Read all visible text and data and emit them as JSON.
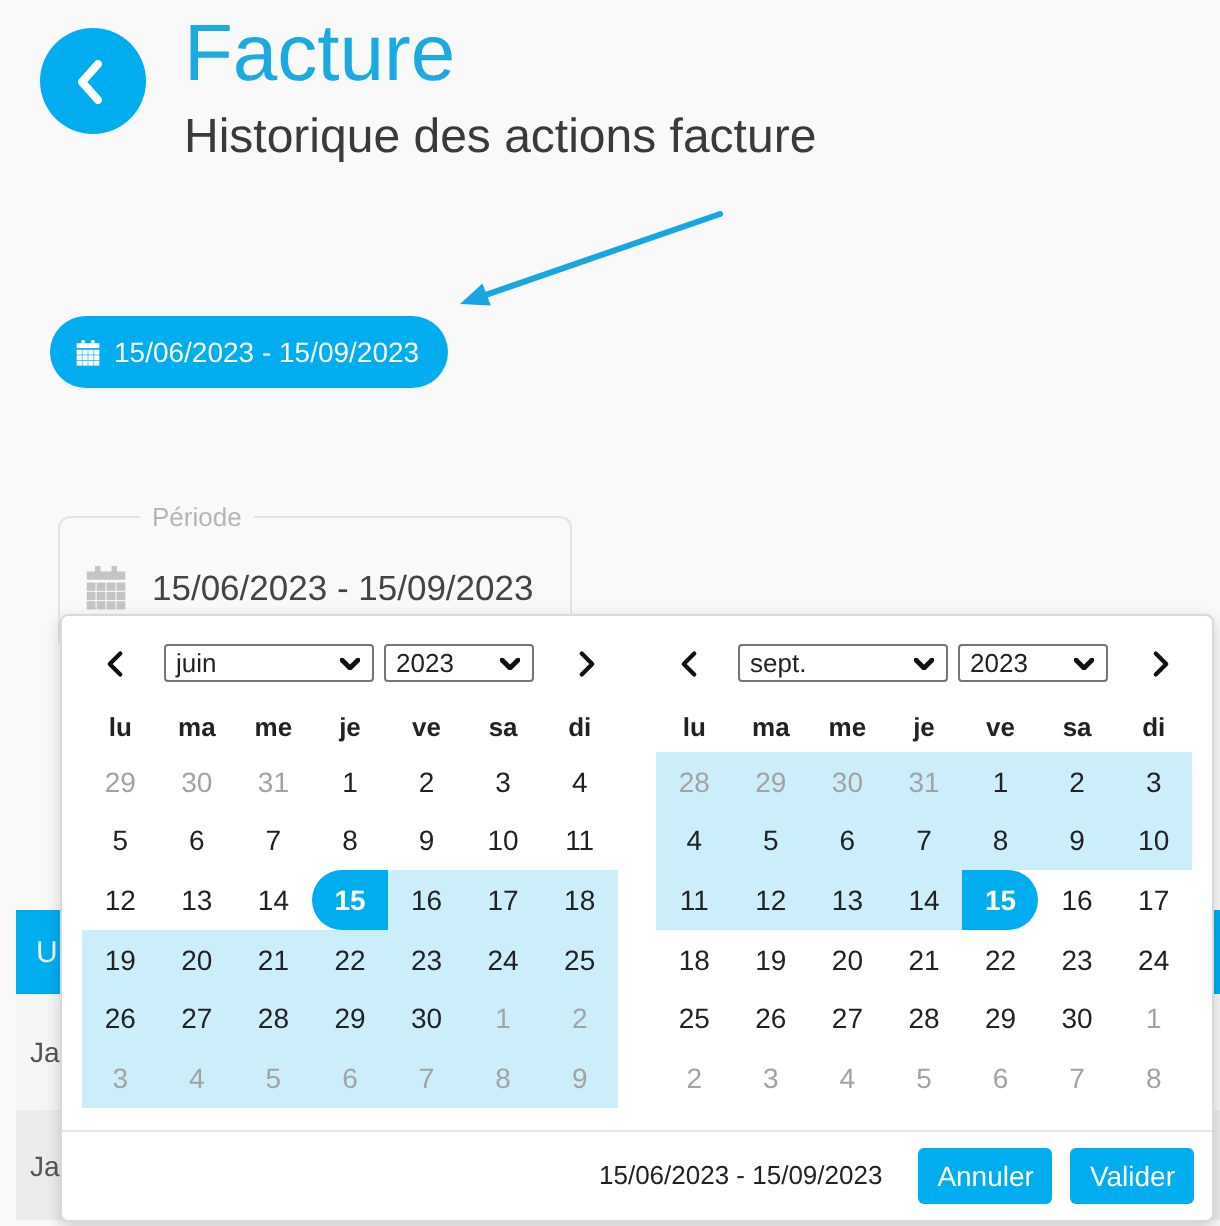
{
  "header": {
    "title": "Facture",
    "subtitle": "Historique des actions facture"
  },
  "date_button": {
    "label": "15/06/2023 - 15/09/2023"
  },
  "period_field": {
    "label": "Période",
    "value": "15/06/2023 - 15/09/2023"
  },
  "table": {
    "columns": [
      "U"
    ],
    "rows": [
      [
        "Ja"
      ],
      [
        "Ja"
      ]
    ]
  },
  "date_picker": {
    "calendars": [
      {
        "month": "juin",
        "year": "2023",
        "weekdays": [
          "lu",
          "ma",
          "me",
          "je",
          "ve",
          "sa",
          "di"
        ],
        "weeks": [
          {
            "days": [
              {
                "label": "29",
                "outside": true,
                "in_range": false,
                "selected": false
              },
              {
                "label": "30",
                "outside": true,
                "in_range": false,
                "selected": false
              },
              {
                "label": "31",
                "outside": true,
                "in_range": false,
                "selected": false
              },
              {
                "label": "1",
                "outside": false,
                "in_range": false,
                "selected": false
              },
              {
                "label": "2",
                "outside": false,
                "in_range": false,
                "selected": false
              },
              {
                "label": "3",
                "outside": false,
                "in_range": false,
                "selected": false
              },
              {
                "label": "4",
                "outside": false,
                "in_range": false,
                "selected": false
              }
            ]
          },
          {
            "days": [
              {
                "label": "5",
                "outside": false,
                "in_range": false,
                "selected": false
              },
              {
                "label": "6",
                "outside": false,
                "in_range": false,
                "selected": false
              },
              {
                "label": "7",
                "outside": false,
                "in_range": false,
                "selected": false
              },
              {
                "label": "8",
                "outside": false,
                "in_range": false,
                "selected": false
              },
              {
                "label": "9",
                "outside": false,
                "in_range": false,
                "selected": false
              },
              {
                "label": "10",
                "outside": false,
                "in_range": false,
                "selected": false
              },
              {
                "label": "11",
                "outside": false,
                "in_range": false,
                "selected": false
              }
            ]
          },
          {
            "days": [
              {
                "label": "12",
                "outside": false,
                "in_range": false,
                "selected": false
              },
              {
                "label": "13",
                "outside": false,
                "in_range": false,
                "selected": false
              },
              {
                "label": "14",
                "outside": false,
                "in_range": false,
                "selected": false
              },
              {
                "label": "15",
                "outside": false,
                "in_range": false,
                "selected": true
              },
              {
                "label": "16",
                "outside": false,
                "in_range": true,
                "selected": false
              },
              {
                "label": "17",
                "outside": false,
                "in_range": true,
                "selected": false
              },
              {
                "label": "18",
                "outside": false,
                "in_range": true,
                "selected": false
              }
            ]
          },
          {
            "days": [
              {
                "label": "19",
                "outside": false,
                "in_range": true,
                "selected": false
              },
              {
                "label": "20",
                "outside": false,
                "in_range": true,
                "selected": false
              },
              {
                "label": "21",
                "outside": false,
                "in_range": true,
                "selected": false
              },
              {
                "label": "22",
                "outside": false,
                "in_range": true,
                "selected": false
              },
              {
                "label": "23",
                "outside": false,
                "in_range": true,
                "selected": false
              },
              {
                "label": "24",
                "outside": false,
                "in_range": true,
                "selected": false
              },
              {
                "label": "25",
                "outside": false,
                "in_range": true,
                "selected": false
              }
            ]
          },
          {
            "days": [
              {
                "label": "26",
                "outside": false,
                "in_range": true,
                "selected": false
              },
              {
                "label": "27",
                "outside": false,
                "in_range": true,
                "selected": false
              },
              {
                "label": "28",
                "outside": false,
                "in_range": true,
                "selected": false
              },
              {
                "label": "29",
                "outside": false,
                "in_range": true,
                "selected": false
              },
              {
                "label": "30",
                "outside": false,
                "in_range": true,
                "selected": false
              },
              {
                "label": "1",
                "outside": true,
                "in_range": true,
                "selected": false
              },
              {
                "label": "2",
                "outside": true,
                "in_range": true,
                "selected": false
              }
            ]
          },
          {
            "days": [
              {
                "label": "3",
                "outside": true,
                "in_range": true,
                "selected": false
              },
              {
                "label": "4",
                "outside": true,
                "in_range": true,
                "selected": false
              },
              {
                "label": "5",
                "outside": true,
                "in_range": true,
                "selected": false
              },
              {
                "label": "6",
                "outside": true,
                "in_range": true,
                "selected": false
              },
              {
                "label": "7",
                "outside": true,
                "in_range": true,
                "selected": false
              },
              {
                "label": "8",
                "outside": true,
                "in_range": true,
                "selected": false
              },
              {
                "label": "9",
                "outside": true,
                "in_range": true,
                "selected": false
              }
            ]
          }
        ]
      },
      {
        "month": "sept.",
        "year": "2023",
        "weekdays": [
          "lu",
          "ma",
          "me",
          "je",
          "ve",
          "sa",
          "di"
        ],
        "weeks": [
          {
            "days": [
              {
                "label": "28",
                "outside": true,
                "in_range": true,
                "selected": false
              },
              {
                "label": "29",
                "outside": true,
                "in_range": true,
                "selected": false
              },
              {
                "label": "30",
                "outside": true,
                "in_range": true,
                "selected": false
              },
              {
                "label": "31",
                "outside": true,
                "in_range": true,
                "selected": false
              },
              {
                "label": "1",
                "outside": false,
                "in_range": true,
                "selected": false
              },
              {
                "label": "2",
                "outside": false,
                "in_range": true,
                "selected": false
              },
              {
                "label": "3",
                "outside": false,
                "in_range": true,
                "selected": false
              }
            ]
          },
          {
            "days": [
              {
                "label": "4",
                "outside": false,
                "in_range": true,
                "selected": false
              },
              {
                "label": "5",
                "outside": false,
                "in_range": true,
                "selected": false
              },
              {
                "label": "6",
                "outside": false,
                "in_range": true,
                "selected": false
              },
              {
                "label": "7",
                "outside": false,
                "in_range": true,
                "selected": false
              },
              {
                "label": "8",
                "outside": false,
                "in_range": true,
                "selected": false
              },
              {
                "label": "9",
                "outside": false,
                "in_range": true,
                "selected": false
              },
              {
                "label": "10",
                "outside": false,
                "in_range": true,
                "selected": false
              }
            ]
          },
          {
            "days": [
              {
                "label": "11",
                "outside": false,
                "in_range": true,
                "selected": false
              },
              {
                "label": "12",
                "outside": false,
                "in_range": true,
                "selected": false
              },
              {
                "label": "13",
                "outside": false,
                "in_range": true,
                "selected": false
              },
              {
                "label": "14",
                "outside": false,
                "in_range": true,
                "selected": false
              },
              {
                "label": "15",
                "outside": false,
                "in_range": false,
                "selected": true
              },
              {
                "label": "16",
                "outside": false,
                "in_range": false,
                "selected": false
              },
              {
                "label": "17",
                "outside": false,
                "in_range": false,
                "selected": false
              }
            ]
          },
          {
            "days": [
              {
                "label": "18",
                "outside": false,
                "in_range": false,
                "selected": false
              },
              {
                "label": "19",
                "outside": false,
                "in_range": false,
                "selected": false
              },
              {
                "label": "20",
                "outside": false,
                "in_range": false,
                "selected": false
              },
              {
                "label": "21",
                "outside": false,
                "in_range": false,
                "selected": false
              },
              {
                "label": "22",
                "outside": false,
                "in_range": false,
                "selected": false
              },
              {
                "label": "23",
                "outside": false,
                "in_range": false,
                "selected": false
              },
              {
                "label": "24",
                "outside": false,
                "in_range": false,
                "selected": false
              }
            ]
          },
          {
            "days": [
              {
                "label": "25",
                "outside": false,
                "in_range": false,
                "selected": false
              },
              {
                "label": "26",
                "outside": false,
                "in_range": false,
                "selected": false
              },
              {
                "label": "27",
                "outside": false,
                "in_range": false,
                "selected": false
              },
              {
                "label": "28",
                "outside": false,
                "in_range": false,
                "selected": false
              },
              {
                "label": "29",
                "outside": false,
                "in_range": false,
                "selected": false
              },
              {
                "label": "30",
                "outside": false,
                "in_range": false,
                "selected": false
              },
              {
                "label": "1",
                "outside": true,
                "in_range": false,
                "selected": false
              }
            ]
          },
          {
            "days": [
              {
                "label": "2",
                "outside": true,
                "in_range": false,
                "selected": false
              },
              {
                "label": "3",
                "outside": true,
                "in_range": false,
                "selected": false
              },
              {
                "label": "4",
                "outside": true,
                "in_range": false,
                "selected": false
              },
              {
                "label": "5",
                "outside": true,
                "in_range": false,
                "selected": false
              },
              {
                "label": "6",
                "outside": true,
                "in_range": false,
                "selected": false
              },
              {
                "label": "7",
                "outside": true,
                "in_range": false,
                "selected": false
              },
              {
                "label": "8",
                "outside": true,
                "in_range": false,
                "selected": false
              }
            ]
          }
        ]
      }
    ],
    "footer": {
      "range": "15/06/2023 - 15/09/2023",
      "buttons": [
        {
          "label": "Annuler"
        },
        {
          "label": "Valider"
        }
      ]
    }
  }
}
